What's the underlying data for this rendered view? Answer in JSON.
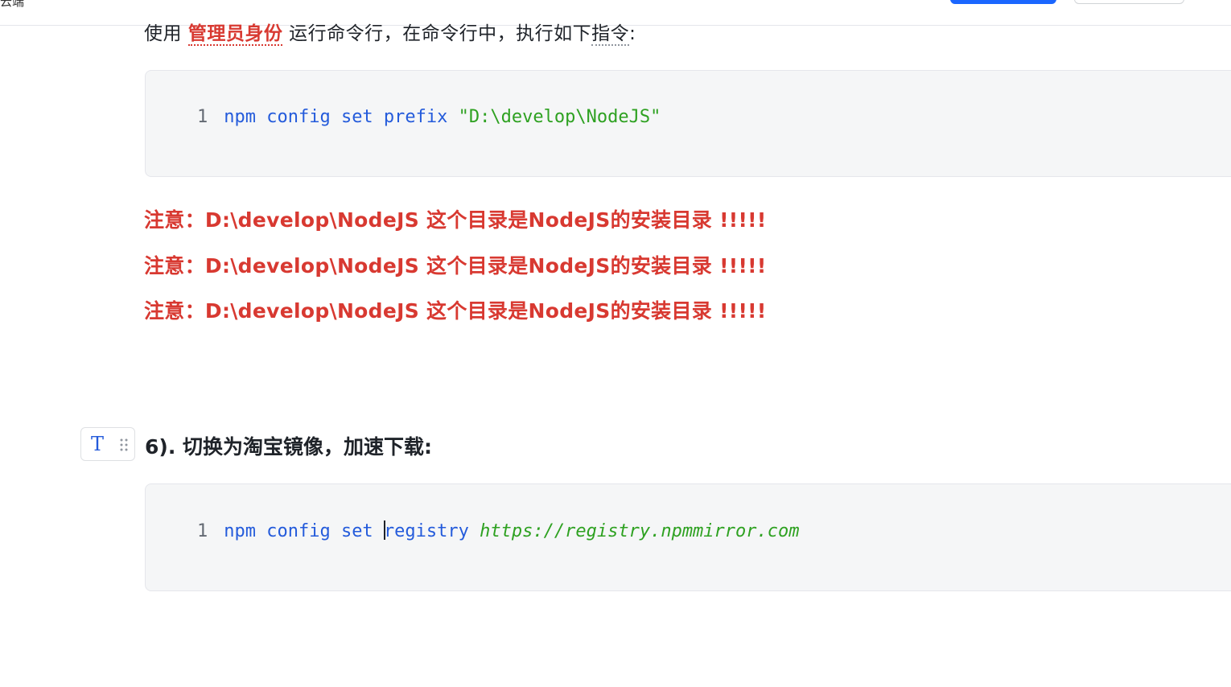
{
  "toolbar": {
    "label": "云端"
  },
  "intro": {
    "prefix": "使用",
    "emphasis": "管理员身份",
    "middle": "运行命令行，在命令行中，执行如下",
    "underlined": "指令",
    "suffix": ":"
  },
  "code1": {
    "line_number": "1",
    "cmd": "npm config set prefix",
    "arg": "\"D:\\develop\\NodeJS\""
  },
  "warnings": [
    "注意：D:\\develop\\NodeJS  这个目录是NodeJS的安装目录 !!!!!",
    "注意：D:\\develop\\NodeJS  这个目录是NodeJS的安装目录 !!!!!",
    "注意：D:\\develop\\NodeJS  这个目录是NodeJS的安装目录 !!!!!"
  ],
  "handle": {
    "type_icon": "T"
  },
  "heading": {
    "text": "6). 切换为淘宝镜像，加速下载:"
  },
  "code2": {
    "line_number": "1",
    "cmd": "npm config set",
    "key_before_cursor": "",
    "key_after_cursor": "registry",
    "url": "https://registry.npmmirror.com"
  },
  "colors": {
    "warning_red": "#d83931",
    "keyword_blue": "#245bdb",
    "string_green": "#2ea121",
    "primary_button": "#1a66ff"
  }
}
